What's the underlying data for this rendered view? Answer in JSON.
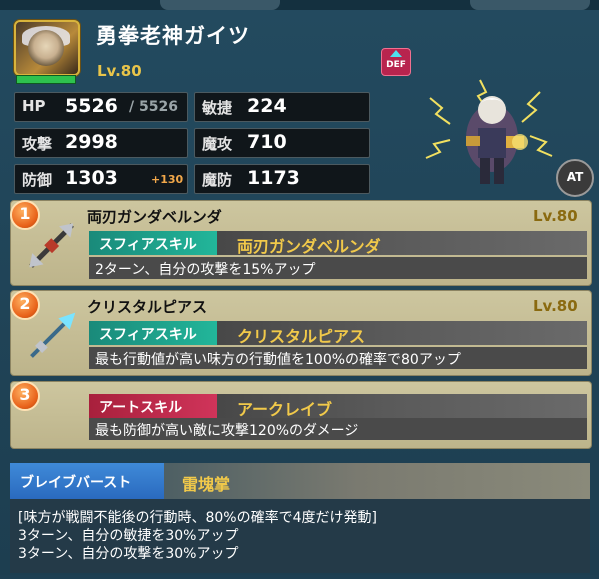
{
  "unit": {
    "name": "勇拳老神ガイツ",
    "level": "Lv.80",
    "type_badge": "DEF",
    "auto_badge": "AT"
  },
  "stats": {
    "hp": {
      "label": "HP",
      "value": "5526",
      "max": "/ 5526"
    },
    "agi": {
      "label": "敏捷",
      "value": "224"
    },
    "atk": {
      "label": "攻撃",
      "value": "2998"
    },
    "mag": {
      "label": "魔攻",
      "value": "710"
    },
    "def": {
      "label": "防御",
      "value": "1303",
      "bonus": "+130"
    },
    "res": {
      "label": "魔防",
      "value": "1173"
    }
  },
  "skills": [
    {
      "number": "1",
      "equip_name": "両刃ガンダベルンダ",
      "level": "Lv.80",
      "tag": "スフィアスキル",
      "skill_name": "両刃ガンダベルンダ",
      "description": "2ターン、自分の攻撃を15%アップ"
    },
    {
      "number": "2",
      "equip_name": "クリスタルピアス",
      "level": "Lv.80",
      "tag": "スフィアスキル",
      "skill_name": "クリスタルピアス",
      "description": "最も行動値が高い味方の行動値を100%の確率で80アップ"
    },
    {
      "number": "3",
      "tag": "アートスキル",
      "skill_name": "アークレイブ",
      "description": "最も防御が高い敵に攻撃120%のダメージ"
    }
  ],
  "brave_burst": {
    "tag": "ブレイブバースト",
    "name": "雷塊掌",
    "lines": [
      "[味方が戦闘不能後の行動時、80%の確率で4度だけ発動]",
      "3ターン、自分の敏捷を30%アップ",
      "3ターン、自分の攻撃を30%アップ"
    ]
  },
  "colors": {
    "gold": "#f1c94a",
    "sphere_tag": "#22b69a",
    "art_tag": "#d0345a",
    "brave_tag": "#2a6abf",
    "number_badge": "#e8621a"
  }
}
